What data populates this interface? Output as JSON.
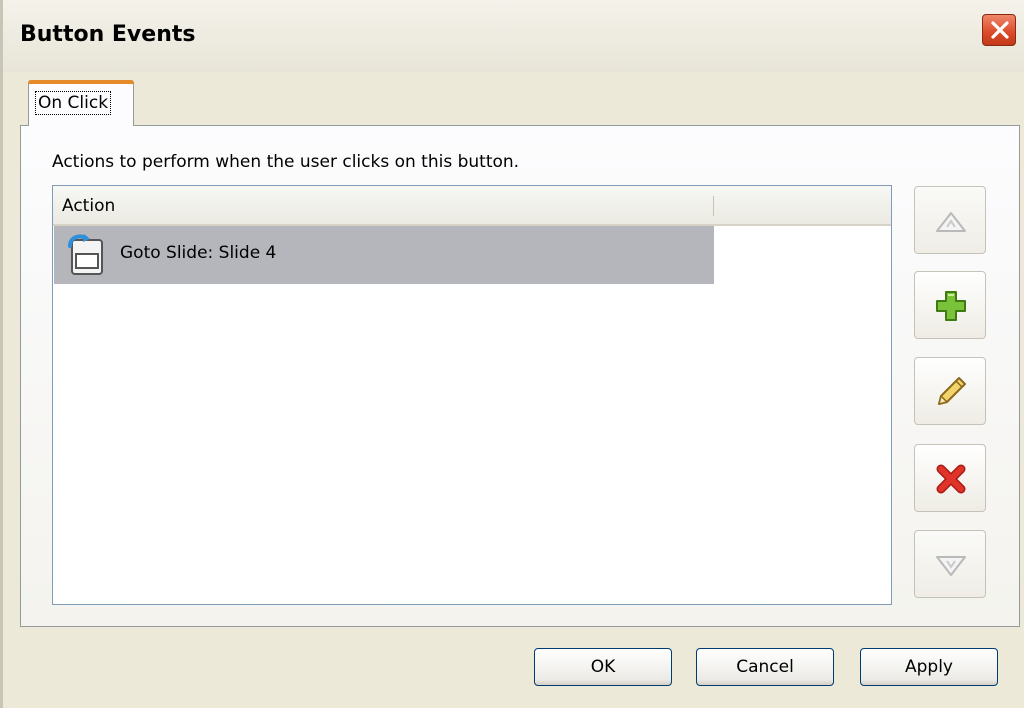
{
  "window": {
    "title": "Button Events"
  },
  "tabs": [
    {
      "label": "On Click",
      "selected": true
    }
  ],
  "panel": {
    "instruction": "Actions to perform when the user clicks on this button."
  },
  "list": {
    "columns": [
      "Action",
      ""
    ],
    "rows": [
      {
        "label": "Goto Slide: Slide 4",
        "icon": "goto-slide-icon",
        "selected": true
      }
    ]
  },
  "side_buttons": [
    {
      "name": "move-up-button",
      "icon": "arrow-up-icon",
      "enabled": false
    },
    {
      "name": "add-action-button",
      "icon": "plus-icon",
      "enabled": true
    },
    {
      "name": "edit-action-button",
      "icon": "pencil-icon",
      "enabled": true
    },
    {
      "name": "delete-action-button",
      "icon": "delete-x-icon",
      "enabled": true
    },
    {
      "name": "move-down-button",
      "icon": "arrow-down-icon",
      "enabled": false
    }
  ],
  "buttons": {
    "ok": "OK",
    "cancel": "Cancel",
    "apply": "Apply"
  },
  "colors": {
    "dialog_bg": "#ece9d8",
    "tab_accent": "#e68b2c",
    "selected_row": "#b5b6bb",
    "close_button": "#d94a28",
    "plus_icon": "#7ac23a",
    "delete_icon": "#e0332a"
  }
}
